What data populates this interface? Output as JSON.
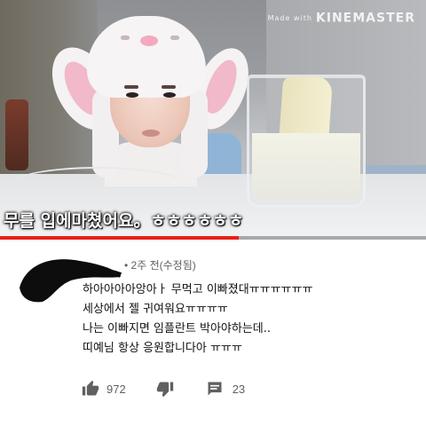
{
  "video": {
    "watermark_prefix": "Made with",
    "watermark_brand": "KINEMASTER",
    "caption": "무를 입에마쳤어요。ㅎㅎㅎㅎㅎㅎ",
    "progress": 0.56
  },
  "comment": {
    "timestamp": "• 2주 전(수정됨)",
    "lines": [
      "하아아아아앙아ㅏ 무먹고 이빠졌대ㅠㅠㅠㅠㅠㅠ",
      "세상에서 젤 귀여워요ㅠㅠㅠㅠ",
      "나는 이빠지면 임플란트 박아야하는데..",
      "띠예님 항상 응원합니다아 ㅠㅠㅠ"
    ],
    "likes": "972",
    "replies": "23"
  },
  "icons": {
    "like": "thumbs-up-icon",
    "dislike": "thumbs-down-icon",
    "reply": "comment-icon"
  },
  "colors": {
    "progress": "#e62117",
    "meta_text": "#606060"
  }
}
